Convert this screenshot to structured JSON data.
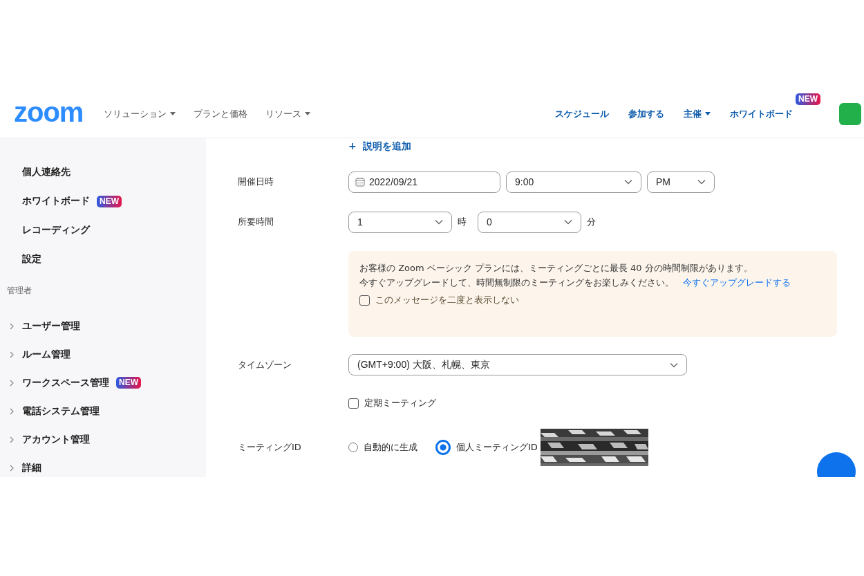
{
  "header": {
    "logo": "zoom",
    "nav": [
      {
        "label": "ソリューション",
        "caret": true
      },
      {
        "label": "プランと価格",
        "caret": false
      },
      {
        "label": "リソース",
        "caret": true
      }
    ],
    "actions": [
      {
        "label": "スケジュール",
        "caret": false
      },
      {
        "label": "参加する",
        "caret": false
      },
      {
        "label": "主催",
        "caret": true
      },
      {
        "label": "ホワイトボード",
        "caret": false,
        "badge": "NEW"
      }
    ]
  },
  "sidebar": {
    "items": [
      {
        "label": "個人連絡先"
      },
      {
        "label": "ホワイトボード",
        "badge": "NEW"
      },
      {
        "label": "レコーディング"
      },
      {
        "label": "設定"
      }
    ],
    "admin_heading": "管理者",
    "admin_items": [
      {
        "label": "ユーザー管理",
        "expanded": false
      },
      {
        "label": "ルーム管理",
        "expanded": false
      },
      {
        "label": "ワークスペース管理",
        "expanded": false,
        "badge": "NEW"
      },
      {
        "label": "電話システム管理",
        "expanded": false
      },
      {
        "label": "アカウント管理",
        "expanded": false
      },
      {
        "label": "詳細",
        "expanded": false
      }
    ]
  },
  "form": {
    "add_description": {
      "icon": "+",
      "label": "説明を追加"
    },
    "date_row": {
      "label": "開催日時",
      "date": "2022/09/21",
      "time": "9:00",
      "ampm": "PM"
    },
    "duration_row": {
      "label": "所要時間",
      "hours": "1",
      "hours_unit": "時",
      "minutes": "0",
      "minutes_unit": "分"
    },
    "notice": {
      "line1": "お客様の Zoom ベーシック プランには、ミーティングごとに最長 40 分の時間制限があります。",
      "line2": "今すぐアップグレードして、時間無制限のミーティングをお楽しみください。",
      "link": "今すぐアップグレードする",
      "checkbox": {
        "label": "このメッセージを二度と表示しない",
        "checked": false
      }
    },
    "timezone_row": {
      "label": "タイムゾーン",
      "value": "(GMT+9:00) 大阪、札幌、東京"
    },
    "recurring": {
      "label": "定期ミーティング",
      "checked": false
    },
    "meeting_id_row": {
      "label": "ミーティングID",
      "options": [
        {
          "label": "自動的に生成",
          "selected": false
        },
        {
          "label": "個人ミーティングID",
          "selected": true
        }
      ]
    }
  }
}
